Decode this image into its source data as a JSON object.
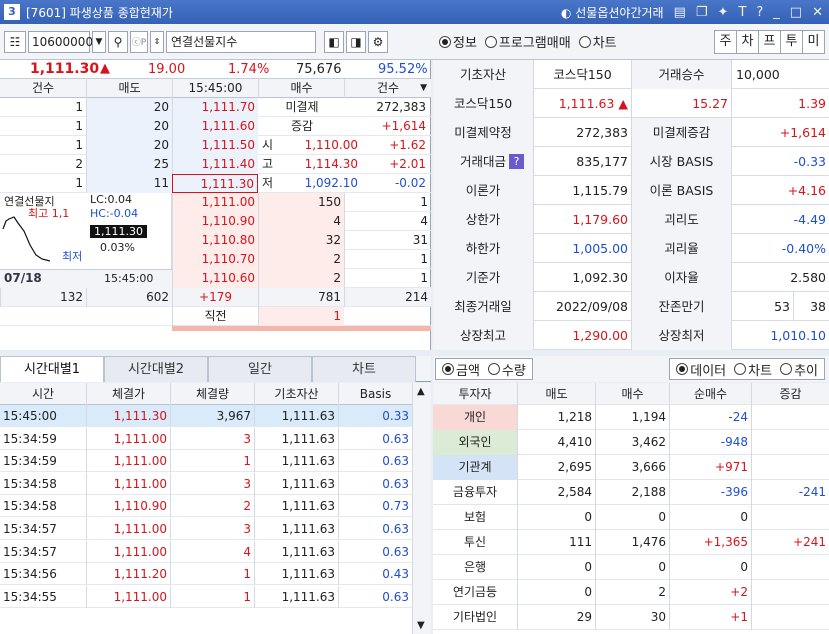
{
  "window": {
    "number": "3",
    "title": "[7601] 파생상품 종합현재가",
    "right_label": "선물옵션야간거래"
  },
  "toolbar": {
    "code": "10600000",
    "code_hint": "ⓒP",
    "name": "연결선물지수"
  },
  "view": {
    "radios": [
      "정보",
      "프로그램매매",
      "차트"
    ],
    "selected": "정보",
    "tabs": [
      "주",
      "차",
      "프",
      "투",
      "미"
    ]
  },
  "quote": {
    "price": "1,111.30",
    "change": "19.00",
    "rate": "1.74%",
    "volume": "75,676",
    "ratio": "95.52%"
  },
  "orderbook": {
    "headers": [
      "건수",
      "매도",
      "15:45:00",
      "매수",
      "건수"
    ],
    "asks": [
      {
        "cnt": "1",
        "qty": "20",
        "price": "1,111.70"
      },
      {
        "cnt": "1",
        "qty": "20",
        "price": "1,111.60"
      },
      {
        "cnt": "1",
        "qty": "20",
        "price": "1,111.50"
      },
      {
        "cnt": "2",
        "qty": "25",
        "price": "1,111.40"
      },
      {
        "cnt": "1",
        "qty": "11",
        "price": "1,111.30"
      }
    ],
    "bids": [
      {
        "price": "1,111.00",
        "qty": "150",
        "cnt": "1"
      },
      {
        "price": "1,110.90",
        "qty": "4",
        "cnt": "4"
      },
      {
        "price": "1,110.80",
        "qty": "32",
        "cnt": "31"
      },
      {
        "price": "1,110.70",
        "qty": "2",
        "cnt": "1"
      },
      {
        "price": "1,110.60",
        "qty": "2",
        "cnt": "1"
      }
    ],
    "oi_label": "미결제",
    "oi": "272,383",
    "chg_label": "증감",
    "chg": "+1,614",
    "ohlc": [
      {
        "l": "시",
        "v": "1,110.00",
        "d": "+1.62"
      },
      {
        "l": "고",
        "v": "1,114.30",
        "d": "+2.01"
      },
      {
        "l": "저",
        "v": "1,092.10",
        "d": "-0.02"
      }
    ],
    "totals": {
      "cnt_sell": "132",
      "qty_sell": "602",
      "diff": "+179",
      "qty_buy": "781",
      "cnt_buy": "214"
    },
    "last_label": "직전",
    "last_val": "1",
    "mini": {
      "title": "연결선물지",
      "lc": "LC:0.04",
      "hc": "HC:-0.04",
      "hi": "최고 1,1",
      "lo": "최저",
      "price": "1,111.30",
      "rate": "0.03%",
      "date": "07/18",
      "time": "15:45:00"
    }
  },
  "info": {
    "rows": [
      [
        "기초자산",
        "코스닥150",
        "거래승수",
        "10,000"
      ],
      [
        "코스닥150",
        "1,111.63 ▲",
        "15.27",
        "1.39"
      ],
      [
        "미결제약정",
        "272,383",
        "미결제증감",
        "+1,614"
      ],
      [
        "거래대금",
        "835,177",
        "시장 BASIS",
        "-0.33"
      ],
      [
        "이론가",
        "1,115.79",
        "이론 BASIS",
        "+4.16"
      ],
      [
        "상한가",
        "1,179.60",
        "괴리도",
        "-4.49"
      ],
      [
        "하한가",
        "1,005.00",
        "괴리율",
        "-0.40%"
      ],
      [
        "기준가",
        "1,092.30",
        "이자율",
        "2.580"
      ],
      [
        "최종거래일",
        "2022/09/08",
        "잔존만기",
        "53",
        "38"
      ],
      [
        "상장최고",
        "1,290.00",
        "상장최저",
        "1,010.10"
      ]
    ]
  },
  "left_tabs": [
    "시간대별1",
    "시간대별2",
    "일간",
    "차트"
  ],
  "ticks": {
    "headers": [
      "시간",
      "체결가",
      "체결량",
      "기초자산",
      "Basis"
    ],
    "rows": [
      [
        "15:45:00",
        "1,111.30",
        "3,967",
        "1,111.63",
        "0.33"
      ],
      [
        "15:34:59",
        "1,111.00",
        "3",
        "1,111.63",
        "0.63"
      ],
      [
        "15:34:59",
        "1,111.00",
        "1",
        "1,111.63",
        "0.63"
      ],
      [
        "15:34:58",
        "1,111.00",
        "3",
        "1,111.63",
        "0.63"
      ],
      [
        "15:34:58",
        "1,110.90",
        "2",
        "1,111.63",
        "0.73"
      ],
      [
        "15:34:57",
        "1,111.00",
        "3",
        "1,111.63",
        "0.63"
      ],
      [
        "15:34:57",
        "1,111.00",
        "4",
        "1,111.63",
        "0.63"
      ],
      [
        "15:34:56",
        "1,111.20",
        "1",
        "1,111.63",
        "0.43"
      ],
      [
        "15:34:55",
        "1,111.00",
        "1",
        "1,111.63",
        "0.63"
      ]
    ]
  },
  "right_lower": {
    "amount_radios": [
      "금액",
      "수량"
    ],
    "view_radios": [
      "데이터",
      "차트",
      "추이"
    ],
    "headers": [
      "투자자",
      "매도",
      "매수",
      "순매수",
      "증감"
    ],
    "rows": [
      [
        "개인",
        "1,218",
        "1,194",
        "-24",
        ""
      ],
      [
        "외국인",
        "4,410",
        "3,462",
        "-948",
        ""
      ],
      [
        "기관계",
        "2,695",
        "3,666",
        "+971",
        ""
      ],
      [
        "금융투자",
        "2,584",
        "2,188",
        "-396",
        "-241"
      ],
      [
        "보험",
        "0",
        "0",
        "0",
        ""
      ],
      [
        "투신",
        "111",
        "1,476",
        "+1,365",
        "+241"
      ],
      [
        "은행",
        "0",
        "0",
        "0",
        ""
      ],
      [
        "연기금등",
        "0",
        "2",
        "+2",
        ""
      ],
      [
        "기타법인",
        "29",
        "30",
        "+1",
        ""
      ]
    ]
  },
  "colors": {
    "up": "#d8141b",
    "down": "#1f4fd1",
    "title": "#3561b6"
  }
}
